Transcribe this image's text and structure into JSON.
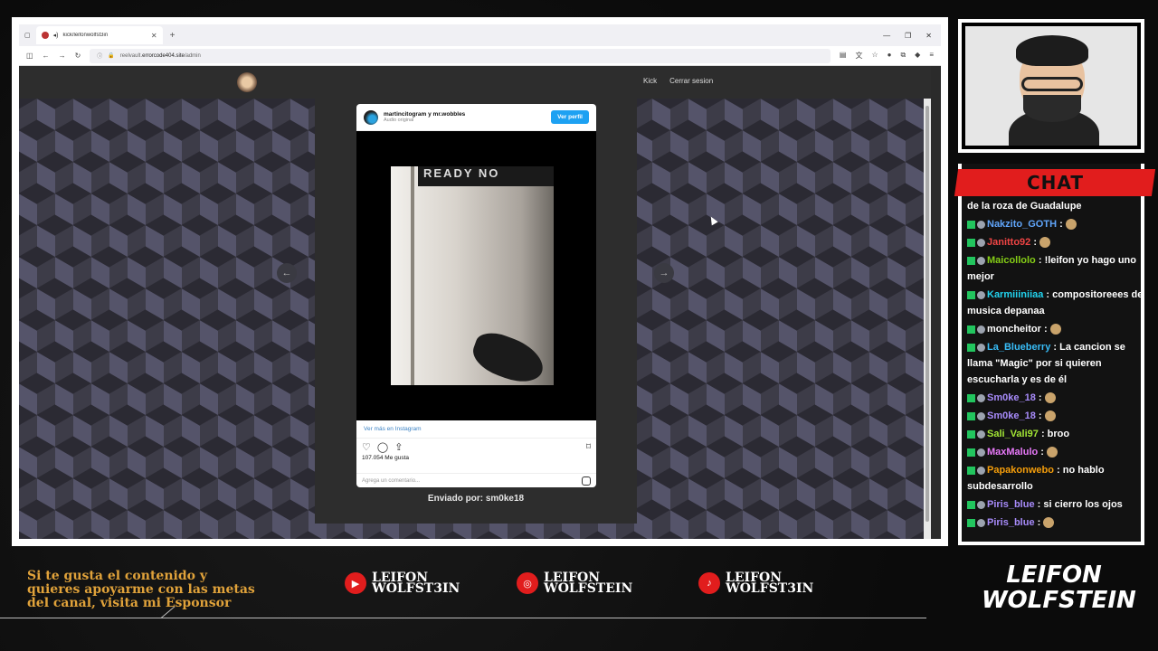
{
  "browser": {
    "tab_title": "kick/leifonwolfst3in",
    "new_tab": "+",
    "url_prefix": "reelvault.",
    "url_host": "errorcode404.site",
    "url_path": "/admin",
    "window_controls": [
      "—",
      "❐",
      "✕"
    ]
  },
  "site": {
    "nav": [
      "Kick",
      "Cerrar sesion"
    ]
  },
  "instagram": {
    "user": "martincitogram y mr.wobbles",
    "audio": "Audio original",
    "profile_button": "Ver perfil",
    "sign_text": "READY  NO",
    "more_link": "Ver más en Instagram",
    "likes": "107.054 Me gusta",
    "comment_placeholder": "Agrega un comentario..."
  },
  "sent_by": "Enviado por: sm0ke18",
  "chat": {
    "title": "CHAT",
    "messages": [
      {
        "user": "",
        "color": "#ffffff",
        "text": "de la roza de Guadalupe"
      },
      {
        "user": "Nakzito_GOTH",
        "color": "#60a5fa",
        "text": ":"
      },
      {
        "user": "Janitto92",
        "color": "#ef4444",
        "text": ":"
      },
      {
        "user": "Maicollolo",
        "color": "#84cc16",
        "text": ": !leifon yo hago uno mejor"
      },
      {
        "user": "Karmiiiniiaa",
        "color": "#22d3ee",
        "text": ": compositoreees de musica depanaa"
      },
      {
        "user": "moncheitor",
        "color": "#ffffff",
        "text": ":"
      },
      {
        "user": "La_Blueberry",
        "color": "#38bdf8",
        "text": ": La cancion se llama \"Magic\" por si quieren escucharla y es de él"
      },
      {
        "user": "Sm0ke_18",
        "color": "#a78bfa",
        "text": ":"
      },
      {
        "user": "Sm0ke_18",
        "color": "#a78bfa",
        "text": ":"
      },
      {
        "user": "Sali_Vali97",
        "color": "#a3e635",
        "text": ": broo"
      },
      {
        "user": "MaxMalulo",
        "color": "#e879f9",
        "text": ":"
      },
      {
        "user": "Papakonwebo",
        "color": "#f59e0b",
        "text": ": no hablo subdesarrollo"
      },
      {
        "user": "Piris_blue",
        "color": "#a78bfa",
        "text": ": si cierro los ojos"
      },
      {
        "user": "Piris_blue",
        "color": "#a78bfa",
        "text": ":"
      }
    ]
  },
  "footer": {
    "sponsor_text": "Si te gusta el contenido y quieres apoyarme con las metas del canal, visita mi Esponsor",
    "socials": [
      {
        "icon": "youtube-icon",
        "line1": "LEIFON",
        "line2": "WOLFST3IN"
      },
      {
        "icon": "instagram-icon",
        "line1": "LEIFON",
        "line2": "WOLFSTEIN"
      },
      {
        "icon": "tiktok-icon",
        "line1": "LEIFON",
        "line2": "WOLFST3IN"
      }
    ],
    "brand_top": "LEIFON",
    "brand_bottom": "WOLFSTEIN"
  },
  "colors": {
    "accent_red": "#e11d1d",
    "sponsor_gold": "#e0a23a"
  }
}
